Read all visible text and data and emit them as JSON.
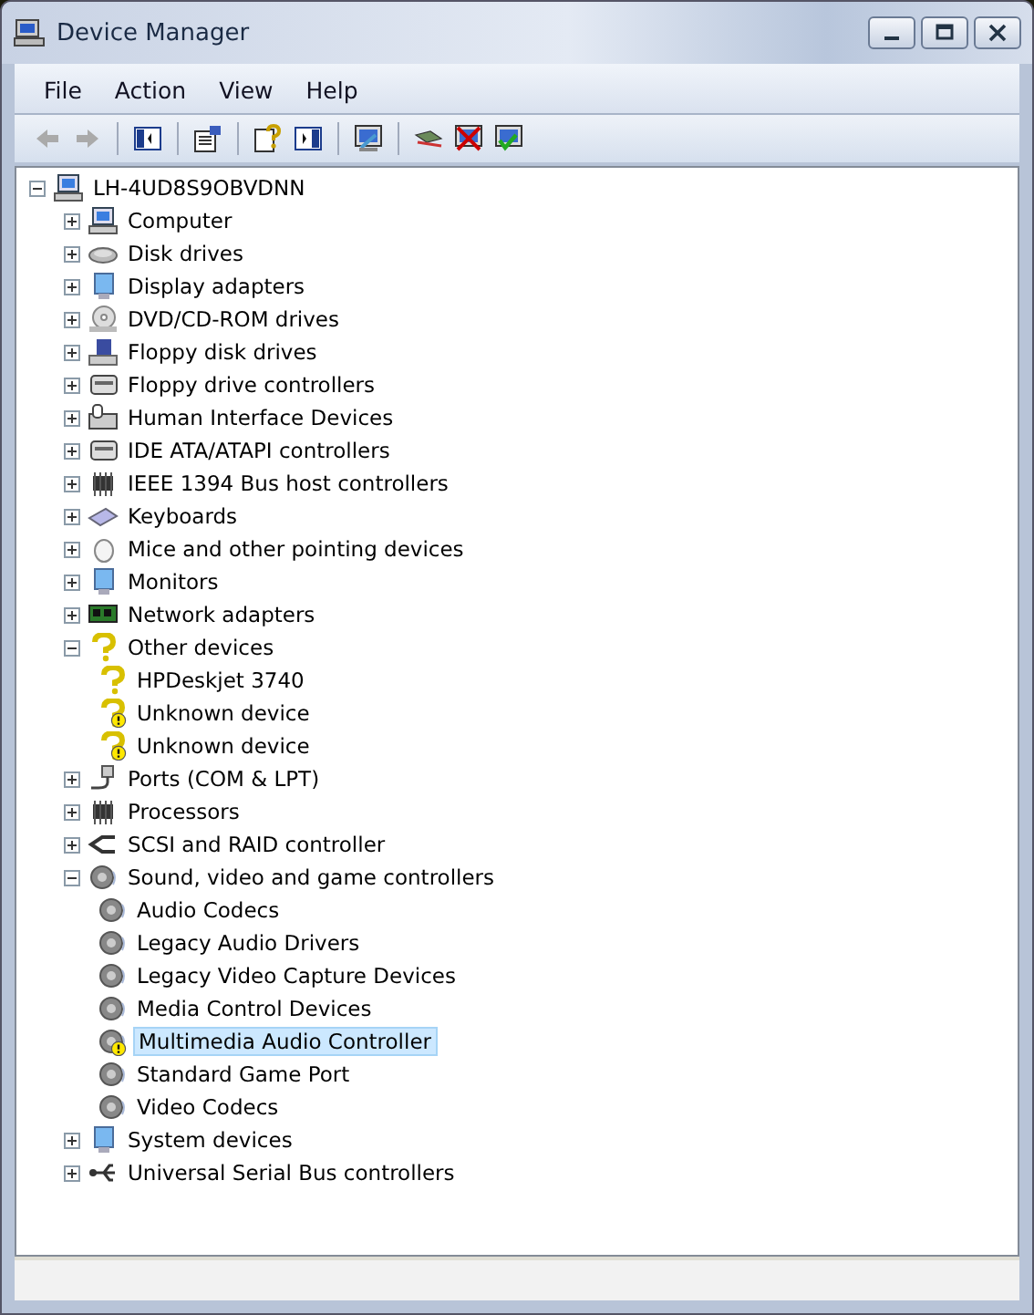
{
  "window": {
    "title": "Device Manager"
  },
  "menu": [
    "File",
    "Action",
    "View",
    "Help"
  ],
  "tree": {
    "label": "LH-4UD8S9OBVDNN",
    "kind": "computer",
    "expanded": true,
    "selected": false,
    "children": [
      {
        "label": "Computer",
        "kind": "computer",
        "expanded": false,
        "selected": false
      },
      {
        "label": "Disk drives",
        "kind": "disk",
        "expanded": false,
        "selected": false
      },
      {
        "label": "Display adapters",
        "kind": "monitor",
        "expanded": false,
        "selected": false
      },
      {
        "label": "DVD/CD-ROM drives",
        "kind": "disc",
        "expanded": false,
        "selected": false
      },
      {
        "label": "Floppy disk drives",
        "kind": "floppy",
        "expanded": false,
        "selected": false
      },
      {
        "label": "Floppy drive controllers",
        "kind": "controller",
        "expanded": false,
        "selected": false
      },
      {
        "label": "Human Interface Devices",
        "kind": "hid",
        "expanded": false,
        "selected": false
      },
      {
        "label": "IDE ATA/ATAPI controllers",
        "kind": "controller",
        "expanded": false,
        "selected": false
      },
      {
        "label": "IEEE 1394 Bus host controllers",
        "kind": "chip",
        "expanded": false,
        "selected": false
      },
      {
        "label": "Keyboards",
        "kind": "keyboard",
        "expanded": false,
        "selected": false
      },
      {
        "label": "Mice and other pointing devices",
        "kind": "mouse",
        "expanded": false,
        "selected": false
      },
      {
        "label": "Monitors",
        "kind": "monitor",
        "expanded": false,
        "selected": false
      },
      {
        "label": "Network adapters",
        "kind": "network",
        "expanded": false,
        "selected": false
      },
      {
        "label": "Other devices",
        "kind": "question",
        "expanded": true,
        "selected": false,
        "children": [
          {
            "label": "HPDeskjet 3740",
            "kind": "question",
            "warning": false,
            "selected": false
          },
          {
            "label": "Unknown device",
            "kind": "question",
            "warning": true,
            "selected": false
          },
          {
            "label": "Unknown device",
            "kind": "question",
            "warning": true,
            "selected": false
          }
        ]
      },
      {
        "label": "Ports (COM & LPT)",
        "kind": "port",
        "expanded": false,
        "selected": false
      },
      {
        "label": "Processors",
        "kind": "chip",
        "expanded": false,
        "selected": false
      },
      {
        "label": "SCSI and RAID controller",
        "kind": "scsi",
        "expanded": false,
        "selected": false
      },
      {
        "label": "Sound, video and game controllers",
        "kind": "speaker",
        "expanded": true,
        "selected": false,
        "children": [
          {
            "label": "Audio Codecs",
            "kind": "speaker",
            "warning": false,
            "selected": false
          },
          {
            "label": "Legacy Audio Drivers",
            "kind": "speaker",
            "warning": false,
            "selected": false
          },
          {
            "label": "Legacy Video Capture Devices",
            "kind": "speaker",
            "warning": false,
            "selected": false
          },
          {
            "label": "Media Control Devices",
            "kind": "speaker",
            "warning": false,
            "selected": false
          },
          {
            "label": "Multimedia Audio Controller",
            "kind": "speaker",
            "warning": true,
            "selected": true
          },
          {
            "label": "Standard Game Port",
            "kind": "speaker",
            "warning": false,
            "selected": false
          },
          {
            "label": "Video Codecs",
            "kind": "speaker",
            "warning": false,
            "selected": false
          }
        ]
      },
      {
        "label": "System devices",
        "kind": "monitor",
        "expanded": false,
        "selected": false
      },
      {
        "label": "Universal Serial Bus controllers",
        "kind": "usb",
        "expanded": false,
        "selected": false
      }
    ]
  }
}
